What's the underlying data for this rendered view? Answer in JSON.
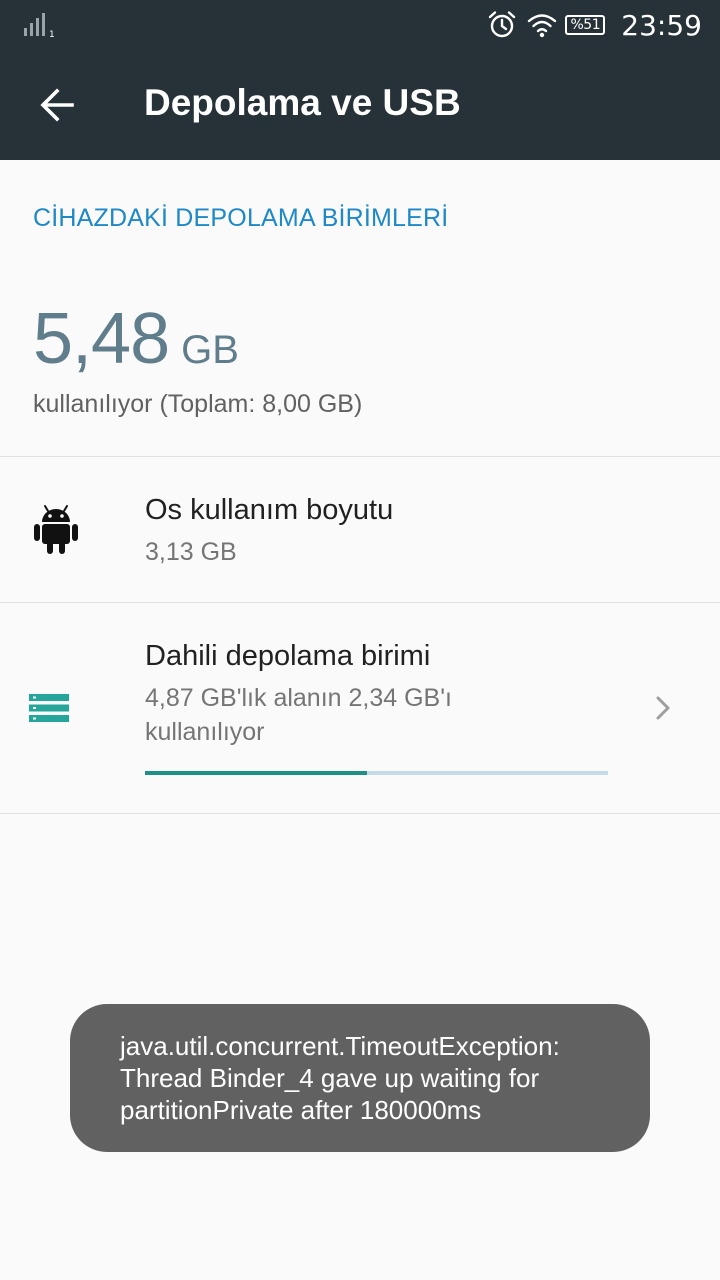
{
  "status_bar": {
    "battery_text": "%51",
    "time": "23:59",
    "icons": [
      "signal-icon",
      "alarm-icon",
      "wifi-icon",
      "battery-icon"
    ]
  },
  "app_bar": {
    "title": "Depolama ve USB",
    "back_icon": "arrow-back-icon"
  },
  "section": {
    "header": "CİHAZDAKİ DEPOLAMA BİRİMLERİ"
  },
  "summary": {
    "used_value": "5,48",
    "used_unit": "GB",
    "total_line": "kullanılıyor (Toplam: 8,00 GB)"
  },
  "items": [
    {
      "icon": "android-icon",
      "title": "Os kullanım boyutu",
      "subtitle": "3,13 GB"
    },
    {
      "icon": "storage-icon",
      "title": "Dahili depolama birimi",
      "subtitle_line1": "4,87 GB'lık alanın 2,34 GB'ı",
      "subtitle_line2": "kullanılıyor",
      "usage_fraction": 0.48,
      "chevron_icon": "chevron-right-icon"
    }
  ],
  "toast": {
    "line1": "java.util.concurrent.TimeoutException:",
    "line2": "Thread Binder_4 gave up waiting for",
    "line3": "partitionPrivate after 180000ms"
  },
  "colors": {
    "app_bar": "#263238",
    "accent": "#1e88c8",
    "progress_fill": "#1f9088",
    "progress_track": "#c5dbe9",
    "storage_icon": "#26a69a"
  }
}
